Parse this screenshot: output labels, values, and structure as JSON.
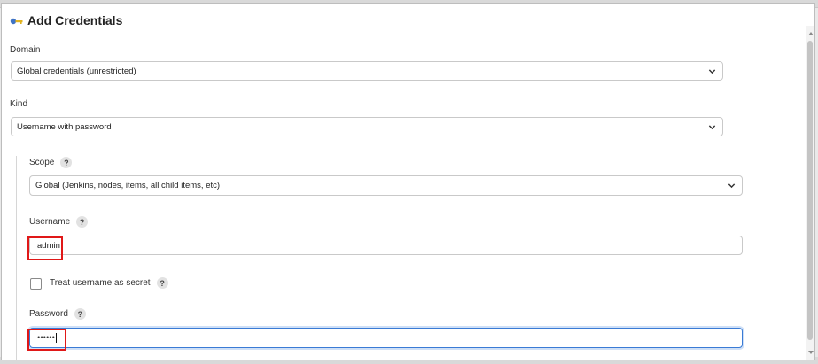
{
  "dialog": {
    "title": "Add Credentials",
    "icon": "key-icon"
  },
  "domain": {
    "label": "Domain",
    "selected": "Global credentials (unrestricted)"
  },
  "kind": {
    "label": "Kind",
    "selected": "Username with password"
  },
  "scope": {
    "label": "Scope",
    "help": "?",
    "selected": "Global (Jenkins, nodes, items, all child items, etc)"
  },
  "username": {
    "label": "Username",
    "help": "?",
    "value": "admin"
  },
  "treat_secret": {
    "label": "Treat username as secret",
    "help": "?",
    "checked": false
  },
  "password": {
    "label": "Password",
    "help": "?",
    "value": "••••••"
  },
  "colors": {
    "highlight": "#e01818",
    "focus": "#3a7bd5"
  }
}
